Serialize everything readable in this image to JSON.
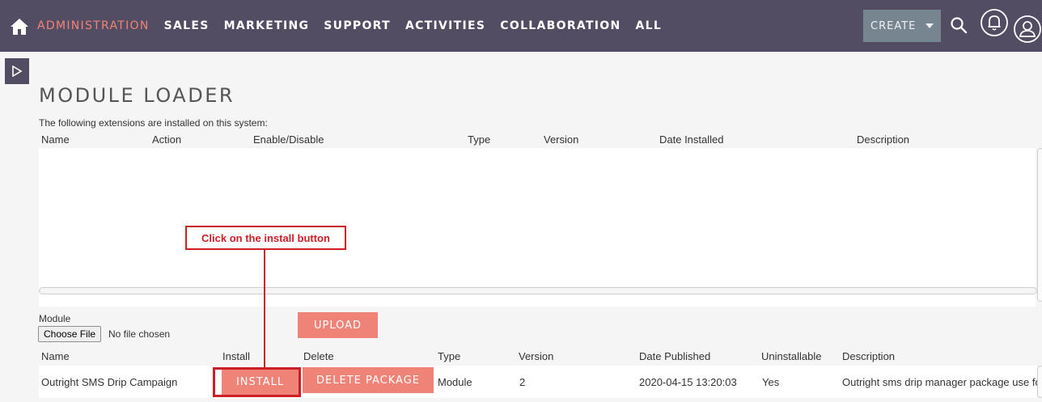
{
  "nav": {
    "items": [
      "ADMINISTRATION",
      "SALES",
      "MARKETING",
      "SUPPORT",
      "ACTIVITIES",
      "COLLABORATION",
      "ALL"
    ],
    "active_item": "ADMINISTRATION",
    "create_label": "CREATE",
    "icons": [
      "home-icon",
      "search-icon",
      "notification-bell-icon",
      "user-profile-icon"
    ]
  },
  "page": {
    "title": "MODULE LOADER",
    "installed_intro": "The following extensions are installed on this system:"
  },
  "installed_table": {
    "columns": [
      "Name",
      "Action",
      "Enable/Disable",
      "Type",
      "Version",
      "Date Installed",
      "Description"
    ],
    "rows": []
  },
  "upload": {
    "module_label": "Module",
    "choose_file_label": "Choose File",
    "no_file_text": "No file chosen",
    "upload_label": "UPLOAD"
  },
  "packages_table": {
    "columns": [
      "Name",
      "Install",
      "Delete",
      "Type",
      "Version",
      "Date Published",
      "Uninstallable",
      "Description"
    ],
    "rows": [
      {
        "name": "Outright SMS Drip Campaign",
        "install_label": "INSTALL",
        "delete_label": "DELETE PACKAGE",
        "type": "Module",
        "version": "2",
        "date_published": "2020-04-15 13:20:03",
        "uninstallable": "Yes",
        "description": "Outright sms drip manager package use for"
      }
    ]
  },
  "annotation": {
    "text": "Click on the install button"
  },
  "colors": {
    "navbar": "#534d64",
    "accent": "#f08377",
    "create_button": "#778591",
    "annotation": "#cc1f26"
  }
}
